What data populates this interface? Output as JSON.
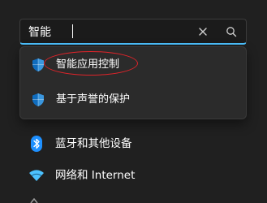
{
  "search": {
    "value": "智能",
    "placeholder": "",
    "clear_icon": "close-icon",
    "search_icon": "search-icon"
  },
  "suggestions": [
    {
      "label": "智能应用控制",
      "icon": "shield-icon",
      "highlighted": true
    },
    {
      "label": "基于声誉的保护",
      "icon": "shield-icon",
      "highlighted": false
    }
  ],
  "annotation": {
    "color": "#e0242a"
  },
  "nav": {
    "items": [
      {
        "label": "蓝牙和其他设备",
        "icon": "bluetooth-icon"
      },
      {
        "label": "网络和 Internet",
        "icon": "wifi-icon"
      }
    ]
  },
  "colors": {
    "background": "#202020",
    "accent": "#4cc2ff",
    "shield_blue": "#0f6cbd",
    "bluetooth_blue": "#1e90ff"
  }
}
